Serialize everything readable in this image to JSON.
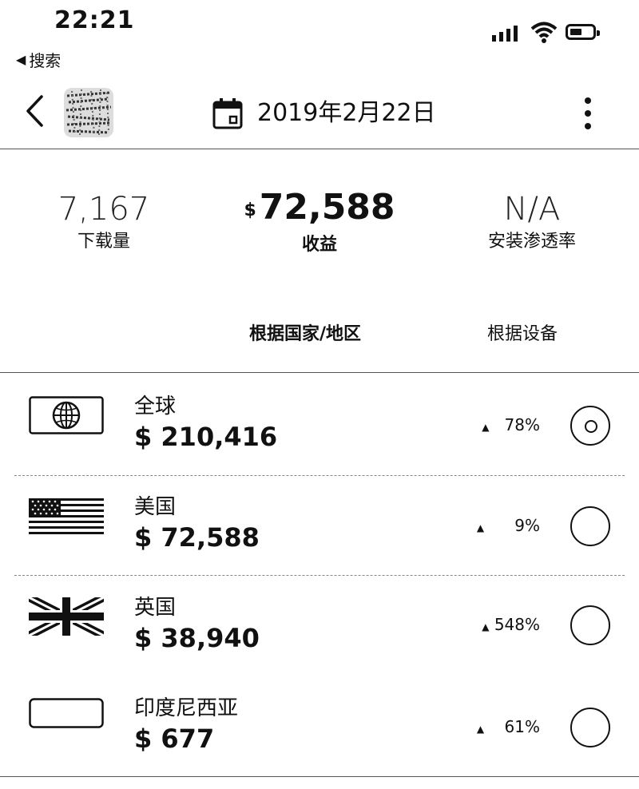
{
  "status_bar": {
    "time": "22:21",
    "back_label": "搜索"
  },
  "header": {
    "date": "2019年2月22日"
  },
  "metrics": {
    "downloads": {
      "value": "7,167",
      "label": "下载量"
    },
    "revenue": {
      "currency": "$",
      "value": "72,588",
      "label": "收益"
    },
    "install_rate": {
      "value": "N/A",
      "label": "安装渗透率"
    }
  },
  "tabs": [
    {
      "label": "根据国家/地区",
      "active": true
    },
    {
      "label": "根据设备",
      "active": false
    }
  ],
  "rows": [
    {
      "name": "全球",
      "amount": "$ 210,416",
      "change": "78%",
      "selected": true,
      "flag": "globe-icon"
    },
    {
      "name": "美国",
      "amount": "$ 72,588",
      "change": "9%",
      "selected": false,
      "flag": "us-flag-icon"
    },
    {
      "name": "英国",
      "amount": "$ 38,940",
      "change": "548%",
      "selected": false,
      "flag": "uk-flag-icon"
    },
    {
      "name": "印度尼西亚",
      "amount": "$ 677",
      "change": "61%",
      "selected": false,
      "flag": "indonesia-flag-icon"
    }
  ],
  "colors": {
    "text": "#111111",
    "background": "#ffffff",
    "divider": "#555555"
  }
}
